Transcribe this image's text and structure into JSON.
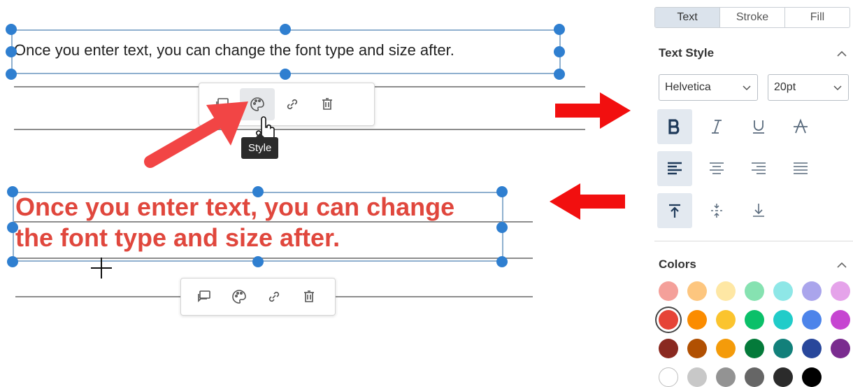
{
  "canvas": {
    "top_text": "Once you enter text, you can change the font type and size after.",
    "bottom_text_line1": "Once you enter text, you can change",
    "bottom_text_line2": "the font type and size after.",
    "tooltip": "Style",
    "toolbar_icons": [
      "comment-icon",
      "palette-icon",
      "link-icon",
      "trash-icon"
    ]
  },
  "panel": {
    "tabs": [
      "Text",
      "Stroke",
      "Fill"
    ],
    "active_tab": "Text",
    "text_style_title": "Text Style",
    "font_family": "Helvetica",
    "font_size": "20pt",
    "colors_title": "Colors",
    "colors": [
      [
        "#f4a09a",
        "#fdc67f",
        "#fee7a4",
        "#86e2b1",
        "#8ee7e7",
        "#aaa5ec",
        "#e5a3ea"
      ],
      [
        "#e64437",
        "#fb8c00",
        "#fbc42e",
        "#0bc069",
        "#21ccc9",
        "#4c84ea",
        "#c645d1"
      ],
      [
        "#8a2920",
        "#b15002",
        "#f49b0a",
        "#047a3a",
        "#12807a",
        "#28479b",
        "#7a2c8f"
      ],
      [
        "#ffffff",
        "#c8c8c8",
        "#939393",
        "#666666",
        "#2b2b2b",
        "#000000"
      ]
    ],
    "selected_color": "#e64437"
  },
  "accent": {
    "handle": "#2f7fd0",
    "arrow": "#f24545",
    "text_red": "#e0473d"
  }
}
